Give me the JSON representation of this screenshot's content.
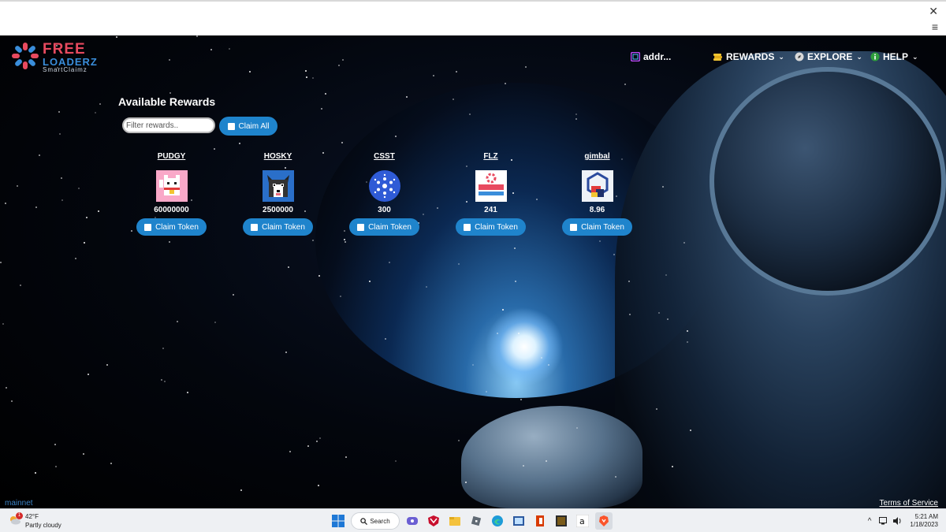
{
  "browser": {
    "close_glyph": "✕",
    "menu_glyph": "≡"
  },
  "logo": {
    "line1": "FREE",
    "line2": "LOADERZ",
    "line3": "SmartClaimz"
  },
  "nav": {
    "wallet": {
      "label": "addr...",
      "icon": "wallet-icon"
    },
    "rewards": {
      "label": "REWARDS",
      "icon": "coins-icon"
    },
    "explore": {
      "label": "EXPLORE",
      "icon": "compass-icon"
    },
    "help": {
      "label": "HELP",
      "icon": "info-icon"
    },
    "chevron": "⌄"
  },
  "rewards": {
    "title": "Available Rewards",
    "filter_placeholder": "Filter rewards..",
    "claim_all_label": "Claim All",
    "tokens": [
      {
        "name": "PUDGY",
        "amount": "60000000",
        "claim_label": "Claim Token",
        "icon": "lucky-cat-icon"
      },
      {
        "name": "HOSKY",
        "amount": "2500000",
        "claim_label": "Claim Token",
        "icon": "husky-icon"
      },
      {
        "name": "CSST",
        "amount": "300",
        "claim_label": "Claim Token",
        "icon": "cardano-icon"
      },
      {
        "name": "FLZ",
        "amount": "241",
        "claim_label": "Claim Token",
        "icon": "freeloaderz-logo-icon"
      },
      {
        "name": "gimbal",
        "amount": "8.96",
        "claim_label": "Claim Token",
        "icon": "gimbal-icon"
      }
    ]
  },
  "footer": {
    "network": "mainnet",
    "terms": "Terms of Service"
  },
  "taskbar": {
    "weather_temp": "42°F",
    "weather_condition": "Partly cloudy",
    "weather_badge": "1",
    "search_label": "Search",
    "time": "5:21 AM",
    "date": "1/18/2023"
  },
  "colors": {
    "accent": "#1f84cc",
    "logo_red": "#e84a5f",
    "logo_blue": "#3a8edb",
    "network_text": "#3b82c4"
  }
}
